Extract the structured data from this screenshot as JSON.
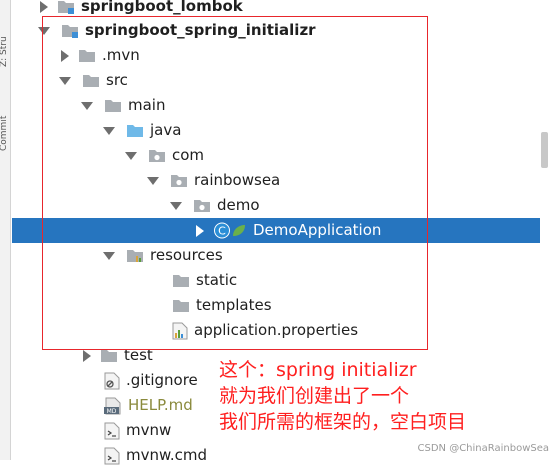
{
  "side_strip": {
    "structure_label": "Z: Stru",
    "commit_label": "Commit"
  },
  "tree": [
    {
      "label": "springboot_lombok",
      "icon": "module-folder-icon",
      "expanded": false,
      "bold": true
    },
    {
      "label": "springboot_spring_initializr",
      "icon": "module-folder-icon",
      "expanded": true,
      "bold": true
    },
    {
      "label": ".mvn",
      "icon": "folder-icon",
      "expanded": false
    },
    {
      "label": "src",
      "icon": "folder-icon",
      "expanded": true
    },
    {
      "label": "main",
      "icon": "folder-icon",
      "expanded": true
    },
    {
      "label": "java",
      "icon": "source-folder-icon",
      "expanded": true
    },
    {
      "label": "com",
      "icon": "package-icon",
      "expanded": true
    },
    {
      "label": "rainbowsea",
      "icon": "package-icon",
      "expanded": true
    },
    {
      "label": "demo",
      "icon": "package-icon",
      "expanded": true
    },
    {
      "label": "DemoApplication",
      "icon": "spring-class-icon",
      "expanded": false,
      "selected": true
    },
    {
      "label": "resources",
      "icon": "resources-folder-icon",
      "expanded": true
    },
    {
      "label": "static",
      "icon": "folder-icon"
    },
    {
      "label": "templates",
      "icon": "folder-icon"
    },
    {
      "label": "application.properties",
      "icon": "properties-file-icon"
    },
    {
      "label": "test",
      "icon": "folder-icon",
      "expanded": false
    },
    {
      "label": ".gitignore",
      "icon": "gitignore-file-icon"
    },
    {
      "label": "HELP.md",
      "icon": "markdown-file-icon"
    },
    {
      "label": "mvnw",
      "icon": "script-file-icon"
    },
    {
      "label": "mvnw.cmd",
      "icon": "script-file-icon"
    }
  ],
  "annotation": {
    "line1": "这个：spring initializr",
    "line2": "就为我们创建出了一个",
    "line3": "我们所需的框架的，空白项目"
  },
  "watermark": "CSDN @ChinaRainbowSea",
  "colors": {
    "selection": "#2675bf",
    "annotation": "#ff1f1f",
    "folder": "#a9aeb3",
    "source_folder": "#6fb9e8"
  }
}
